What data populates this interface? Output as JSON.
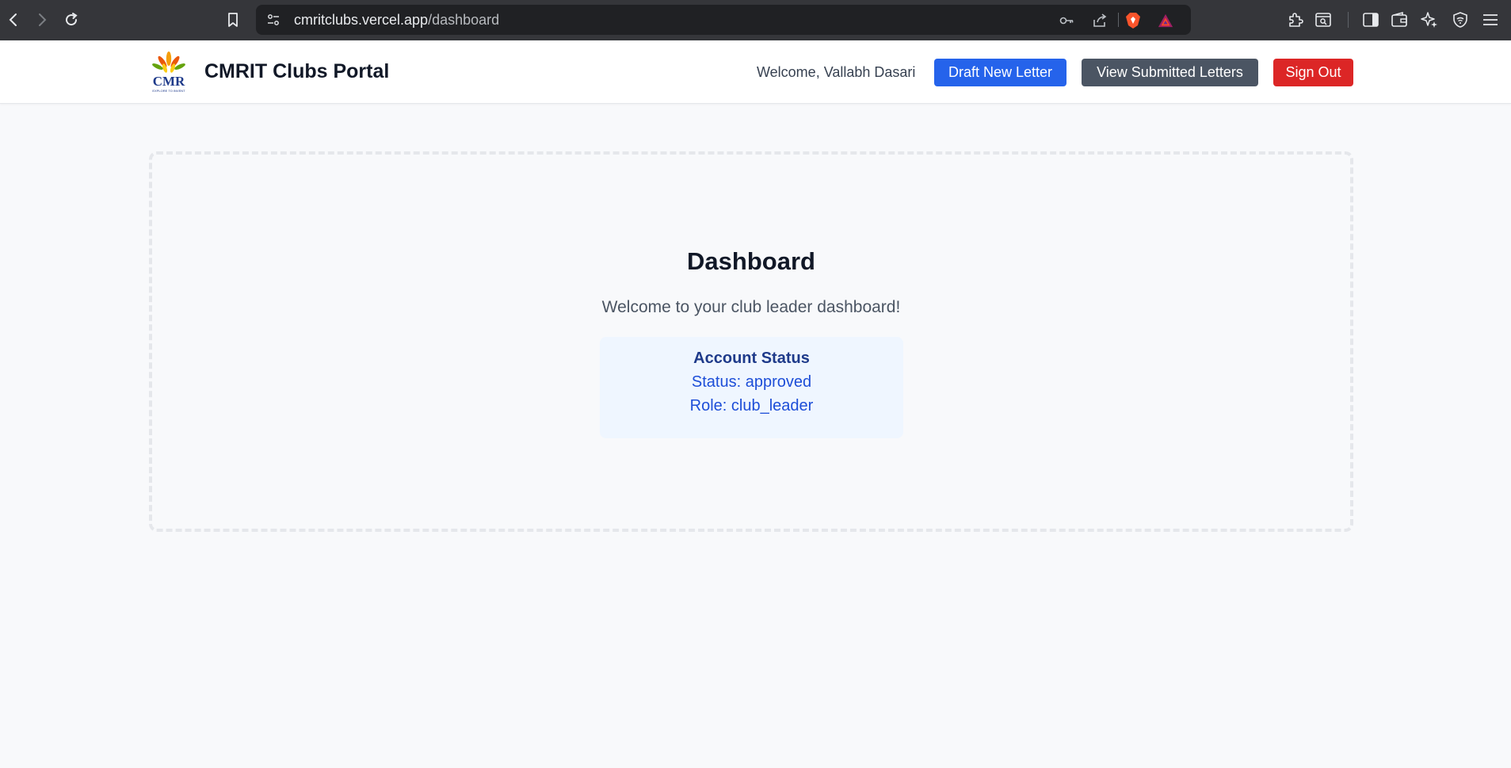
{
  "browser": {
    "url_host": "cmritclubs.vercel.app",
    "url_path": "/dashboard"
  },
  "header": {
    "title": "CMRIT Clubs Portal",
    "welcome": "Welcome, Vallabh Dasari",
    "buttons": {
      "draft": "Draft New Letter",
      "view": "View Submitted Letters",
      "signout": "Sign Out"
    }
  },
  "logo": {
    "text": "CMR",
    "tagline": "EXPLORE TO INVENT"
  },
  "main": {
    "title": "Dashboard",
    "subtitle": "Welcome to your club leader dashboard!",
    "account": {
      "heading": "Account Status",
      "status": "Status: approved",
      "role": "Role: club_leader"
    }
  },
  "colors": {
    "primary": "#2563eb",
    "secondary": "#4b5563",
    "danger": "#dc2626",
    "status_bg": "#eff6ff"
  }
}
